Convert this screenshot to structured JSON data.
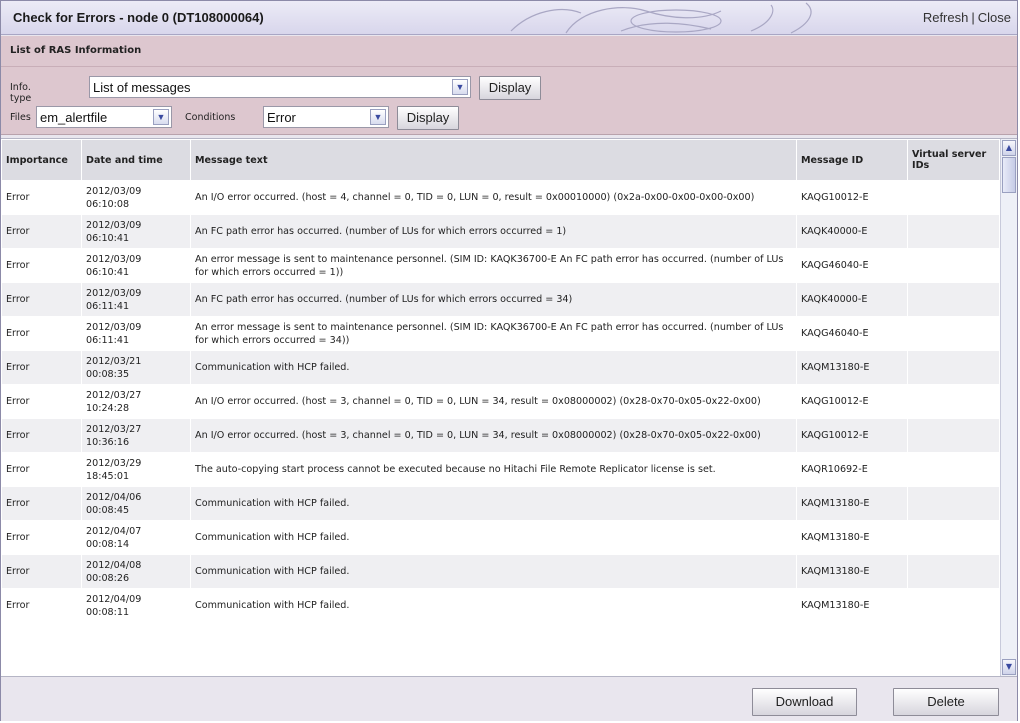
{
  "window": {
    "title": "Check for Errors - node 0 (DT108000064)",
    "refresh_label": "Refresh",
    "separator": "|",
    "close_label": "Close"
  },
  "panel": {
    "title": "List of RAS Information",
    "info_type_label": "Info. type",
    "info_type_value": "List of messages",
    "display_label": "Display",
    "files_label": "Files",
    "files_value": "em_alertfile",
    "conditions_label": "Conditions",
    "conditions_value": "Error"
  },
  "table": {
    "columns": [
      "Importance",
      "Date and time",
      "Message text",
      "Message ID",
      "Virtual server IDs"
    ],
    "rows": [
      {
        "importance": "Error",
        "date": "2012/03/09",
        "time": "06:10:08",
        "message": "An I/O error occurred. (host = 4, channel = 0, TID = 0, LUN = 0, result = 0x00010000) (0x2a-0x00-0x00-0x00-0x00)",
        "message_id": "KAQG10012-E",
        "virtual_server_ids": ""
      },
      {
        "importance": "Error",
        "date": "2012/03/09",
        "time": "06:10:41",
        "message": "An FC path error has occurred. (number of LUs for which errors occurred = 1)",
        "message_id": "KAQK40000-E",
        "virtual_server_ids": ""
      },
      {
        "importance": "Error",
        "date": "2012/03/09",
        "time": "06:10:41",
        "message": "An error message is sent to maintenance personnel. (SIM ID: KAQK36700-E An FC path error has occurred. (number of LUs for which errors occurred = 1))",
        "message_id": "KAQG46040-E",
        "virtual_server_ids": ""
      },
      {
        "importance": "Error",
        "date": "2012/03/09",
        "time": "06:11:41",
        "message": "An FC path error has occurred. (number of LUs for which errors occurred = 34)",
        "message_id": "KAQK40000-E",
        "virtual_server_ids": ""
      },
      {
        "importance": "Error",
        "date": "2012/03/09",
        "time": "06:11:41",
        "message": "An error message is sent to maintenance personnel. (SIM ID: KAQK36700-E An FC path error has occurred. (number of LUs for which errors occurred = 34))",
        "message_id": "KAQG46040-E",
        "virtual_server_ids": ""
      },
      {
        "importance": "Error",
        "date": "2012/03/21",
        "time": "00:08:35",
        "message": "Communication with HCP failed.",
        "message_id": "KAQM13180-E",
        "virtual_server_ids": ""
      },
      {
        "importance": "Error",
        "date": "2012/03/27",
        "time": "10:24:28",
        "message": "An I/O error occurred. (host = 3, channel = 0, TID = 0, LUN = 34, result = 0x08000002) (0x28-0x70-0x05-0x22-0x00)",
        "message_id": "KAQG10012-E",
        "virtual_server_ids": ""
      },
      {
        "importance": "Error",
        "date": "2012/03/27",
        "time": "10:36:16",
        "message": "An I/O error occurred. (host = 3, channel = 0, TID = 0, LUN = 34, result = 0x08000002) (0x28-0x70-0x05-0x22-0x00)",
        "message_id": "KAQG10012-E",
        "virtual_server_ids": ""
      },
      {
        "importance": "Error",
        "date": "2012/03/29",
        "time": "18:45:01",
        "message": "The auto-copying start process cannot be executed because no Hitachi File Remote Replicator license is set.",
        "message_id": "KAQR10692-E",
        "virtual_server_ids": ""
      },
      {
        "importance": "Error",
        "date": "2012/04/06",
        "time": "00:08:45",
        "message": "Communication with HCP failed.",
        "message_id": "KAQM13180-E",
        "virtual_server_ids": ""
      },
      {
        "importance": "Error",
        "date": "2012/04/07",
        "time": "00:08:14",
        "message": "Communication with HCP failed.",
        "message_id": "KAQM13180-E",
        "virtual_server_ids": ""
      },
      {
        "importance": "Error",
        "date": "2012/04/08",
        "time": "00:08:26",
        "message": "Communication with HCP failed.",
        "message_id": "KAQM13180-E",
        "virtual_server_ids": ""
      },
      {
        "importance": "Error",
        "date": "2012/04/09",
        "time": "00:08:11",
        "message": "Communication with HCP failed.",
        "message_id": "KAQM13180-E",
        "virtual_server_ids": ""
      }
    ]
  },
  "footer": {
    "download_label": "Download",
    "delete_label": "Delete"
  }
}
